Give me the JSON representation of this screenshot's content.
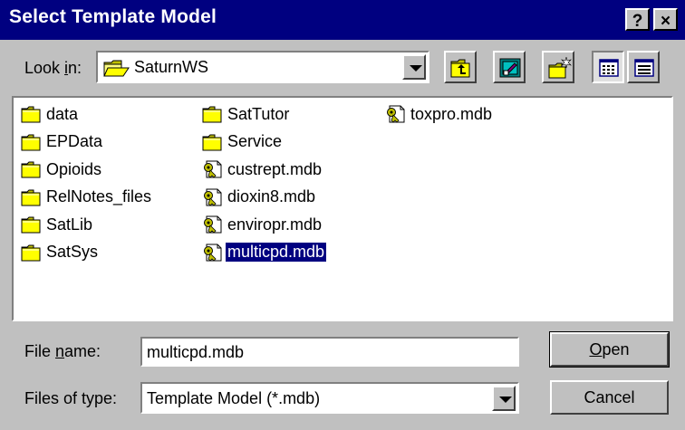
{
  "window": {
    "title": "Select Template Model",
    "help_label": "?",
    "close_label": "×"
  },
  "lookin": {
    "label_pre": "Look ",
    "label_key": "i",
    "label_post": "n:",
    "value": "SaturnWS"
  },
  "files": [
    {
      "name": "data",
      "type": "folder"
    },
    {
      "name": "EPData",
      "type": "folder"
    },
    {
      "name": "Opioids",
      "type": "folder"
    },
    {
      "name": "RelNotes_files",
      "type": "folder"
    },
    {
      "name": "SatLib",
      "type": "folder"
    },
    {
      "name": "SatSys",
      "type": "folder"
    },
    {
      "name": "SatTutor",
      "type": "folder"
    },
    {
      "name": "Service",
      "type": "folder"
    },
    {
      "name": "custrept.mdb",
      "type": "mdb"
    },
    {
      "name": "dioxin8.mdb",
      "type": "mdb"
    },
    {
      "name": "enviropr.mdb",
      "type": "mdb"
    },
    {
      "name": "multicpd.mdb",
      "type": "mdb",
      "selected": true
    },
    {
      "name": "toxpro.mdb",
      "type": "mdb"
    }
  ],
  "filename": {
    "label_pre": "File ",
    "label_key": "n",
    "label_post": "ame:",
    "value": "multicpd.mdb"
  },
  "filetype": {
    "label": "Files of type:",
    "value": "Template Model (*.mdb)"
  },
  "buttons": {
    "open_key": "O",
    "open_rest": "pen",
    "cancel": "Cancel"
  },
  "colors": {
    "titlebar": "#000080",
    "face": "#c0c0c0",
    "selection": "#000080",
    "folder": "#ffff00"
  }
}
